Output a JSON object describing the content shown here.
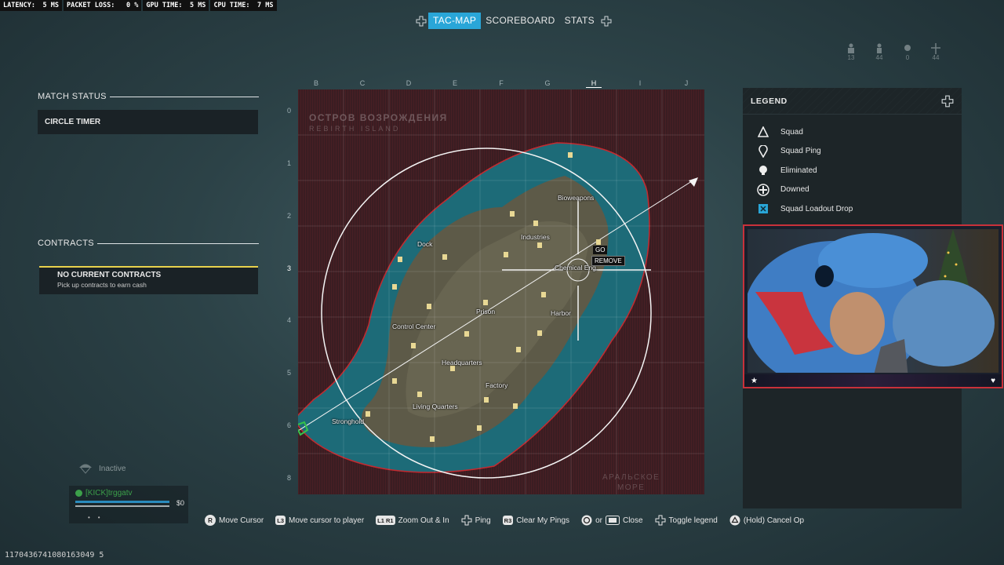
{
  "perf": [
    {
      "label": "LATENCY:",
      "value": "5 MS"
    },
    {
      "label": "PACKET LOSS:",
      "value": "0 %"
    },
    {
      "label": "GPU TIME:",
      "value": "5 MS"
    },
    {
      "label": "CPU TIME:",
      "value": "7 MS"
    }
  ],
  "tabs": [
    {
      "label": "TAC-MAP",
      "active": true
    },
    {
      "label": "SCOREBOARD",
      "active": false
    },
    {
      "label": "STATS",
      "active": false
    }
  ],
  "top_right_counts": [
    {
      "icon": "squad-icon",
      "value": "13"
    },
    {
      "icon": "player-icon",
      "value": "44"
    },
    {
      "icon": "eliminated-icon",
      "value": "0"
    },
    {
      "icon": "plane-icon",
      "value": "44"
    }
  ],
  "left_panel": {
    "match_status_title": "MATCH STATUS",
    "circle_timer": "CIRCLE TIMER",
    "contracts_title": "CONTRACTS",
    "no_contracts": "NO CURRENT CONTRACTS",
    "contracts_hint": "Pick up contracts to earn cash",
    "inactive_label": "Inactive",
    "player_name": "[KICK]trggatv",
    "player_cash": "$0"
  },
  "map": {
    "col_labels": [
      "B",
      "C",
      "D",
      "E",
      "F",
      "G",
      "H",
      "I",
      "J"
    ],
    "active_col": "H",
    "row_labels": [
      "0",
      "1",
      "2",
      "3",
      "4",
      "5",
      "6",
      "8"
    ],
    "active_row": "3",
    "title_ru": "ОСТРОВ ВОЗРОЖДЕНИЯ",
    "title_en": "REBIRTH ISLAND",
    "corner_text_1": "АРАЛЬСКОЕ",
    "corner_text_2": "МОРЕ",
    "pois": {
      "bioweapons": "Bioweapons",
      "industries": "Industries",
      "dock": "Dock",
      "chemical": "Chemical Eng.",
      "prison": "Prison",
      "harbor": "Harbor",
      "control": "Control Center",
      "hq": "Headquarters",
      "factory": "Factory",
      "living": "Living Quarters",
      "stronghold": "Stronghold"
    },
    "go_label": "GO",
    "remove_label": "REMOVE"
  },
  "legend": {
    "title": "LEGEND",
    "items": [
      {
        "icon": "squad-icon",
        "label": "Squad"
      },
      {
        "icon": "squad-ping-icon",
        "label": "Squad Ping"
      },
      {
        "icon": "eliminated-icon",
        "label": "Eliminated"
      },
      {
        "icon": "downed-icon",
        "label": "Downed"
      },
      {
        "icon": "loadout-drop-icon",
        "label": "Squad Loadout Drop"
      }
    ]
  },
  "hints": [
    {
      "button": "R",
      "label": "Move Cursor"
    },
    {
      "button": "L3",
      "label": "Move cursor to player"
    },
    {
      "button": "L1 R1",
      "label": "Zoom Out & In"
    },
    {
      "button": "dpad",
      "label": "Ping"
    },
    {
      "button": "R3",
      "label": "Clear My Pings"
    },
    {
      "button": "circle / touchpad",
      "or": "or",
      "label": "Close"
    },
    {
      "button": "dpad",
      "label": "Toggle legend"
    },
    {
      "button": "triangle",
      "label": "(Hold) Cancel Op"
    }
  ],
  "uid": "1170436741080163049 5",
  "colors": {
    "accent": "#29a6d8",
    "contract_border": "#e8d24c",
    "gas": "#c42a30",
    "water": "#1d6b78"
  }
}
